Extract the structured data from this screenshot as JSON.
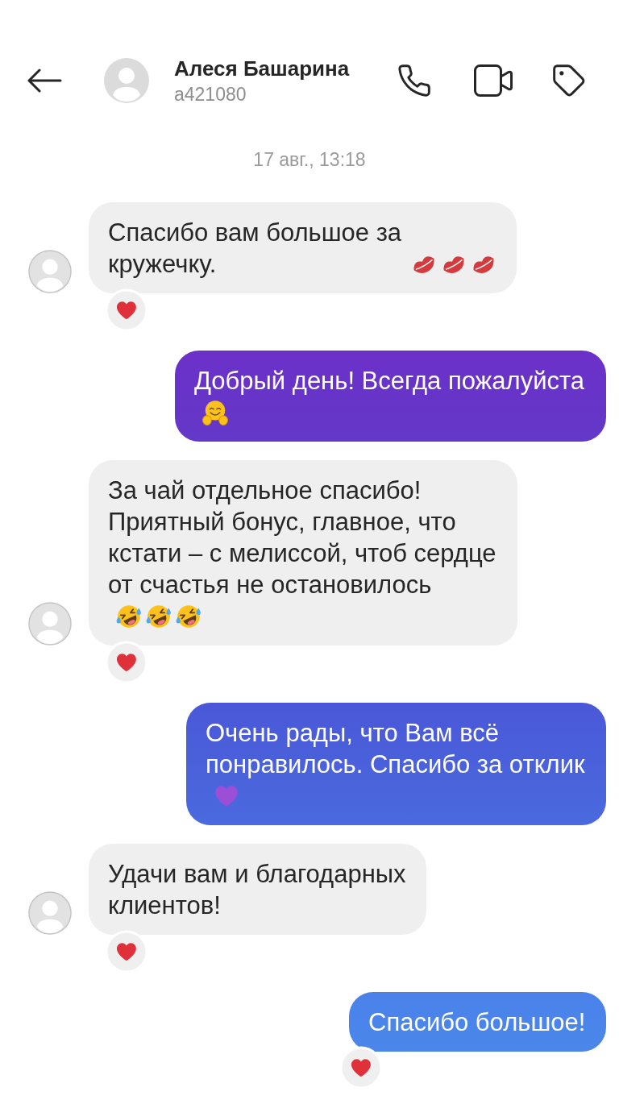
{
  "header": {
    "name": "Алеся Башарина",
    "username": "a421080"
  },
  "date_separator": "17 авг., 13:18",
  "messages": [
    {
      "kind": "received",
      "text": "Спасибо вам большое за кружечку.",
      "emojis": [
        {
          "kind": "kiss"
        },
        {
          "kind": "kiss"
        },
        {
          "kind": "kiss"
        }
      ],
      "reacted": true
    },
    {
      "kind": "sent",
      "text": "Добрый день! Всегда пожалуйста",
      "emojis": [
        {
          "kind": "hug"
        }
      ],
      "reacted": false
    },
    {
      "kind": "received",
      "text": "За чай отдельное спасибо! Приятный бонус, главное, что кстати – с мелиссой, чтоб сердце от счастья не остановилось",
      "emojis": [
        {
          "kind": "rofl"
        },
        {
          "kind": "rofl"
        },
        {
          "kind": "rofl"
        }
      ],
      "reacted": true
    },
    {
      "kind": "sent",
      "text": "Очень рады, что Вам всё понравилось. Спасибо за отклик",
      "emojis": [
        {
          "kind": "heart"
        }
      ],
      "reacted": false
    },
    {
      "kind": "received",
      "text": "Удачи вам и благодарных клиентов!",
      "reacted": true
    },
    {
      "kind": "sent",
      "text": "Спасибо большое!",
      "reacted": true
    }
  ]
}
